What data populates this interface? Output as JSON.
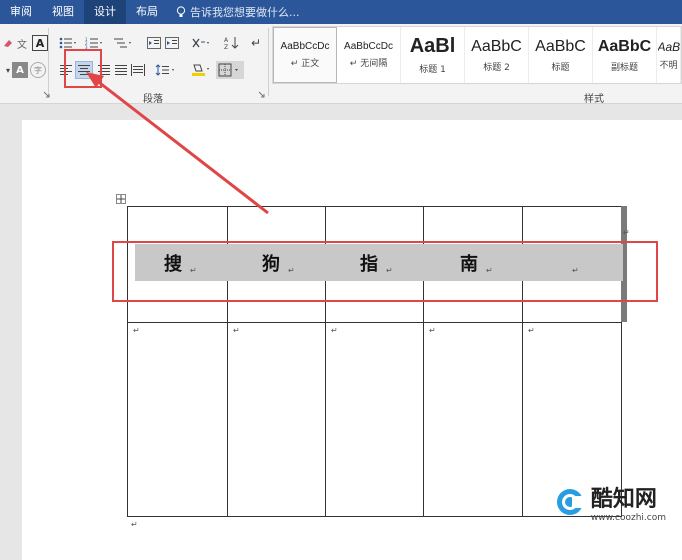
{
  "menubar": {
    "tabs": [
      "审阅",
      "视图",
      "设计",
      "布局"
    ],
    "active_tab": "设计",
    "tellme_placeholder": "告诉我您想要做什么..."
  },
  "ribbon": {
    "paragraph_group_label": "段落",
    "styles_group_label": "样式",
    "styles": [
      {
        "sample": "AaBbCcDc",
        "name": "正文",
        "size": 10
      },
      {
        "sample": "AaBbCcDc",
        "name": "无间隔",
        "size": 10
      },
      {
        "sample": "AaBl",
        "name": "标题 1",
        "size": 20
      },
      {
        "sample": "AaBbC",
        "name": "标题 2",
        "size": 16
      },
      {
        "sample": "AaBbC",
        "name": "标题",
        "size": 16
      },
      {
        "sample": "AaBbC",
        "name": "副标题",
        "size": 16
      },
      {
        "sample": "AaBb",
        "name": "不明",
        "size": 12
      }
    ]
  },
  "table": {
    "header_cells": [
      "搜",
      "狗",
      "指",
      "南",
      ""
    ]
  },
  "watermark": {
    "title": "酷知网",
    "url": "www.coozhi.com"
  },
  "colors": {
    "menubar": "#2b579a",
    "annotation_red": "#e04646",
    "row_shading": "#c8c8c8"
  }
}
